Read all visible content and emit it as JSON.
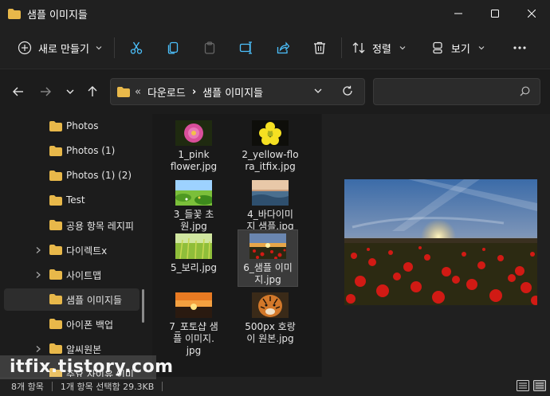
{
  "window": {
    "title": "샘플 이미지들"
  },
  "toolbar": {
    "new_label": "새로 만들기",
    "sort_label": "정렬",
    "view_label": "보기"
  },
  "address": {
    "overflow": "«",
    "parent": "다운로드",
    "separator": "›",
    "current": "샘플 이미지들"
  },
  "sidebar": {
    "items": [
      {
        "label": "Photos",
        "has_children": false,
        "selected": false
      },
      {
        "label": "Photos (1)",
        "has_children": false,
        "selected": false
      },
      {
        "label": "Photos (1) (2)",
        "has_children": false,
        "selected": false
      },
      {
        "label": "Test",
        "has_children": false,
        "selected": false
      },
      {
        "label": "공용 항목 레지피",
        "has_children": false,
        "selected": false
      },
      {
        "label": "다이렉트x",
        "has_children": true,
        "selected": false
      },
      {
        "label": "사이트맵",
        "has_children": true,
        "selected": false
      },
      {
        "label": "샘플 이미지들",
        "has_children": false,
        "selected": true
      },
      {
        "label": "아이폰 백업",
        "has_children": false,
        "selected": false
      },
      {
        "label": "알씨원본",
        "has_children": true,
        "selected": false
      },
      {
        "label": "주요 사이유 이미",
        "has_children": false,
        "selected": false
      }
    ]
  },
  "files": [
    {
      "line1": "1_pink",
      "line2": "flower.jpg",
      "line3": "",
      "thumb": "pink-flower",
      "selected": false
    },
    {
      "line1": "2_yellow-flo",
      "line2": "ra_itfix.jpg",
      "line3": "",
      "thumb": "yellow-flower",
      "selected": false
    },
    {
      "line1": "3_들꽃 초",
      "line2": "원.jpg",
      "line3": "",
      "thumb": "meadow",
      "selected": false
    },
    {
      "line1": "4_바다이미",
      "line2": "지 샘플.jpg",
      "line3": "",
      "thumb": "sea",
      "selected": false
    },
    {
      "line1": "5_보리.jpg",
      "line2": "",
      "line3": "",
      "thumb": "barley",
      "selected": false
    },
    {
      "line1": "6_샘플 이미",
      "line2": "지.jpg",
      "line3": "",
      "thumb": "sunset-poppies",
      "selected": true
    },
    {
      "line1": "7_포토샵 샘",
      "line2": "플 이미지.",
      "line3": "jpg",
      "thumb": "orange-sky",
      "selected": false
    },
    {
      "line1": "500px 호랑",
      "line2": "이 원본.jpg",
      "line3": "",
      "thumb": "tiger",
      "selected": false
    }
  ],
  "status": {
    "count": "8개 항목",
    "selection": "1개 항목 선택함  29.3KB"
  },
  "watermark": {
    "text": "itfix.tistory.com"
  },
  "colors": {
    "folder": "#e8b84a",
    "accent_blue": "#4cc2ff",
    "window_bg": "#1c1c1c"
  }
}
